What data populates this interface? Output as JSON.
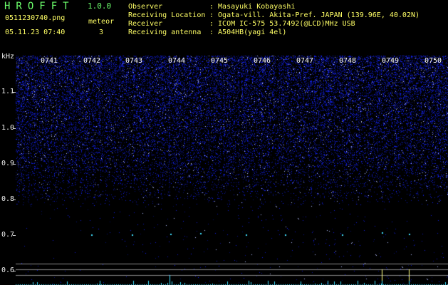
{
  "header": {
    "app_title": "HROFFT",
    "app_version": "1.0.0",
    "filename": "0511230740.png",
    "meteor_label": "meteor",
    "meteor_count": "3",
    "datetime": "05.11.23 07:40",
    "info": [
      {
        "label": "Observer",
        "value": ": Masayuki Kobayashi"
      },
      {
        "label": "Receiving Location",
        "value": ": Ogata-vill. Akita-Pref. JAPAN (139.96E, 40.02N)"
      },
      {
        "label": "Receiver",
        "value": ": ICOM IC-575 53.7492(@LCD)MHz USB"
      },
      {
        "label": "Receiving antenna",
        "value": ": A504HB(yagi 4el)"
      }
    ]
  },
  "spectrogram": {
    "y_unit": "kHz",
    "y_ticks": [
      "1.1",
      "1.0",
      "0.9",
      "0.8",
      "0.7",
      "0.6"
    ],
    "time_labels": [
      "0741",
      "0742",
      "0743",
      "0744",
      "0745",
      "0746",
      "0747",
      "0748",
      "0749",
      "0750"
    ],
    "colors": {
      "noise": "#2a3cff",
      "signal": "#40e0ff",
      "marker": "#ffff80"
    }
  }
}
